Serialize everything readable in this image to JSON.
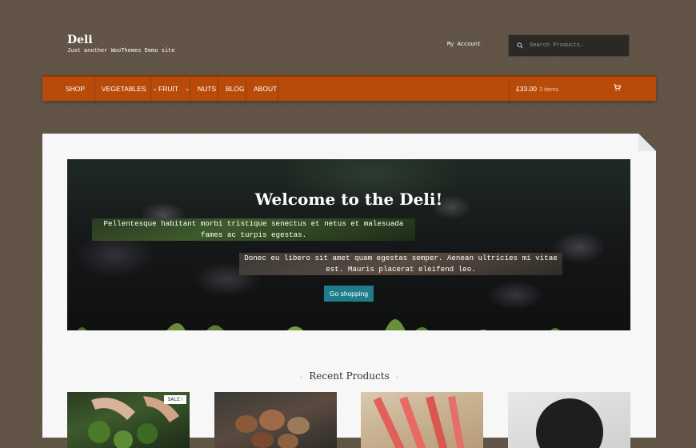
{
  "site": {
    "title": "Deli",
    "tagline": "Just another WooThemes Demo site"
  },
  "header": {
    "my_account": "My Account",
    "search_placeholder": "Search Products…"
  },
  "nav": {
    "items": [
      {
        "label": "Shop",
        "has_dropdown": false
      },
      {
        "label": "Vegetables",
        "has_dropdown": true
      },
      {
        "label": "Fruit",
        "has_dropdown": true
      },
      {
        "label": "Nuts",
        "has_dropdown": false
      },
      {
        "label": "Blog",
        "has_dropdown": false
      },
      {
        "label": "About",
        "has_dropdown": false
      }
    ],
    "cart_total": "£33.00",
    "cart_count": "3 items",
    "cart_icon": "shopping-cart-icon"
  },
  "hero": {
    "title": "Welcome to the Deli!",
    "paragraph1": "Pellentesque habitant morbi tristique senectus et netus et malesuada fames ac turpis egestas.",
    "paragraph2": "Donec eu libero sit amet quam egestas semper. Aenean ultricies mi vitae est. Mauris placerat eleifend leo.",
    "button_label": "Go shopping"
  },
  "recent_products": {
    "title": "Recent Products",
    "sale_badge": "SALE!"
  },
  "colors": {
    "background": "#615446",
    "nav": "#b94b0a",
    "button": "#1f7c8a"
  }
}
